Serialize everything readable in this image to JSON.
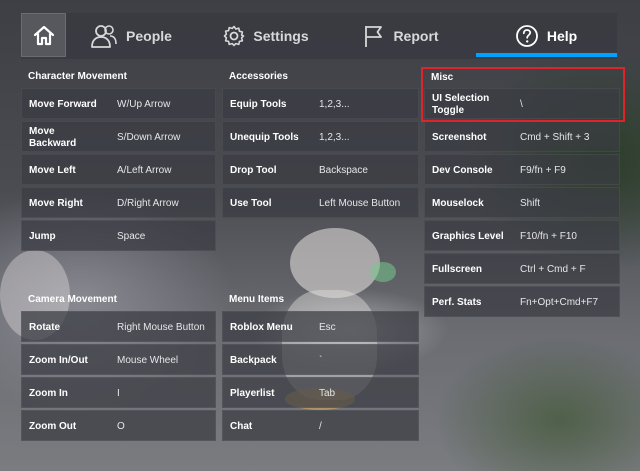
{
  "topbar": {
    "tabs": [
      {
        "label": "People",
        "icon": "people-icon"
      },
      {
        "label": "Settings",
        "icon": "gear-icon"
      },
      {
        "label": "Report",
        "icon": "flag-icon"
      },
      {
        "label": "Help",
        "icon": "question-icon",
        "active": true
      }
    ]
  },
  "colors": {
    "accent": "#00a2ff",
    "highlight": "#e0232b"
  },
  "sections": {
    "character_movement": {
      "title": "Character Movement",
      "rows": [
        {
          "label": "Move Forward",
          "value": "W/Up Arrow"
        },
        {
          "label": "Move Backward",
          "value": "S/Down Arrow"
        },
        {
          "label": "Move Left",
          "value": "A/Left Arrow"
        },
        {
          "label": "Move Right",
          "value": "D/Right Arrow"
        },
        {
          "label": "Jump",
          "value": "Space"
        }
      ]
    },
    "accessories": {
      "title": "Accessories",
      "rows": [
        {
          "label": "Equip Tools",
          "value": "1,2,3..."
        },
        {
          "label": "Unequip Tools",
          "value": "1,2,3..."
        },
        {
          "label": "Drop Tool",
          "value": "Backspace"
        },
        {
          "label": "Use Tool",
          "value": "Left Mouse Button"
        }
      ]
    },
    "misc": {
      "title": "Misc",
      "rows": [
        {
          "label": "UI Selection Toggle",
          "value": "\\"
        },
        {
          "label": "Screenshot",
          "value": "Cmd + Shift + 3"
        },
        {
          "label": "Dev Console",
          "value": "F9/fn + F9"
        },
        {
          "label": "Mouselock",
          "value": "Shift"
        },
        {
          "label": "Graphics Level",
          "value": "F10/fn + F10"
        },
        {
          "label": "Fullscreen",
          "value": "Ctrl + Cmd + F"
        },
        {
          "label": "Perf. Stats",
          "value": "Fn+Opt+Cmd+F7"
        }
      ]
    },
    "camera_movement": {
      "title": "Camera Movement",
      "rows": [
        {
          "label": "Rotate",
          "value": "Right Mouse Button"
        },
        {
          "label": "Zoom In/Out",
          "value": "Mouse Wheel"
        },
        {
          "label": "Zoom In",
          "value": "I"
        },
        {
          "label": "Zoom Out",
          "value": "O"
        }
      ]
    },
    "menu_items": {
      "title": "Menu Items",
      "rows": [
        {
          "label": "Roblox Menu",
          "value": "Esc"
        },
        {
          "label": "Backpack",
          "value": "`"
        },
        {
          "label": "Playerlist",
          "value": "Tab"
        },
        {
          "label": "Chat",
          "value": "/"
        }
      ]
    }
  }
}
